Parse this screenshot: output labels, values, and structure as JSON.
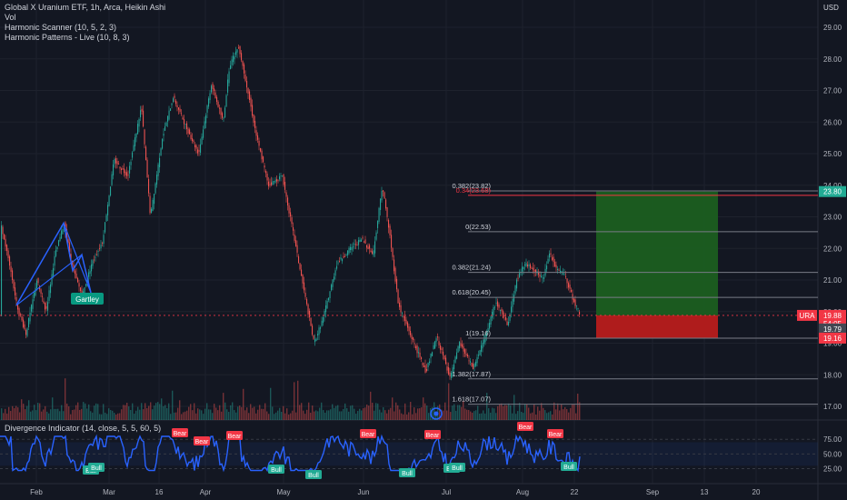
{
  "legend": {
    "title": "Global X Uranium ETF, 1h, Arca, Heikin Ashi",
    "vol": "Vol",
    "scanner": "Harmonic Scanner (10, 5, 2, 3)",
    "patterns": "Harmonic Patterns - Live (10, 8, 3)"
  },
  "currency": "USD",
  "price_axis": [
    "29.00",
    "28.00",
    "27.00",
    "26.00",
    "25.00",
    "24.00",
    "23.00",
    "22.00",
    "21.00",
    "20.00",
    "19.00",
    "18.00",
    "17.00"
  ],
  "time_axis": [
    "Feb",
    "Mar",
    "16",
    "Apr",
    "May",
    "Jun",
    "Jul",
    "Aug",
    "22",
    "Sep",
    "13",
    "20"
  ],
  "fib_levels": [
    {
      "label": "0.382(23.82)",
      "price": 23.82,
      "color": "#787b86"
    },
    {
      "label": "0.34(23.68)",
      "price": 23.68,
      "color": "#f23645"
    },
    {
      "label": "0(22.53)",
      "price": 22.53,
      "color": "#787b86"
    },
    {
      "label": "0.382(21.24)",
      "price": 21.24,
      "color": "#787b86"
    },
    {
      "label": "0.618(20.45)",
      "price": 20.45,
      "color": "#787b86"
    },
    {
      "label": "1(19.16)",
      "price": 19.16,
      "color": "#787b86"
    },
    {
      "label": "1.382(17.87)",
      "price": 17.87,
      "color": "#787b86"
    },
    {
      "label": "1.618(17.07)",
      "price": 17.07,
      "color": "#787b86"
    }
  ],
  "price_tags": [
    {
      "text": "23.80",
      "price": 23.8,
      "color": "#22ab94"
    },
    {
      "text": "19.88",
      "price": 19.88,
      "color": "#f23645",
      "ticker": "URA"
    },
    {
      "text": "54:05",
      "price": 19.62,
      "color": "#f23645"
    },
    {
      "text": "19.79",
      "price": 19.45,
      "color": "#434651"
    },
    {
      "text": "19.16",
      "price": 19.16,
      "color": "#f23645"
    }
  ],
  "pattern_label": "Gartley",
  "divergence": {
    "title": "Divergence Indicator (14, close, 5, 5, 60, 5)",
    "axis": [
      "75.00",
      "50.00",
      "25.00"
    ],
    "bear_label": "Bear",
    "bull_label": "Bull"
  },
  "colors": {
    "bg": "#131722",
    "up": "#26a69a",
    "down": "#ef5350",
    "rsi": "#2962ff",
    "grid": "#1e222d"
  }
}
